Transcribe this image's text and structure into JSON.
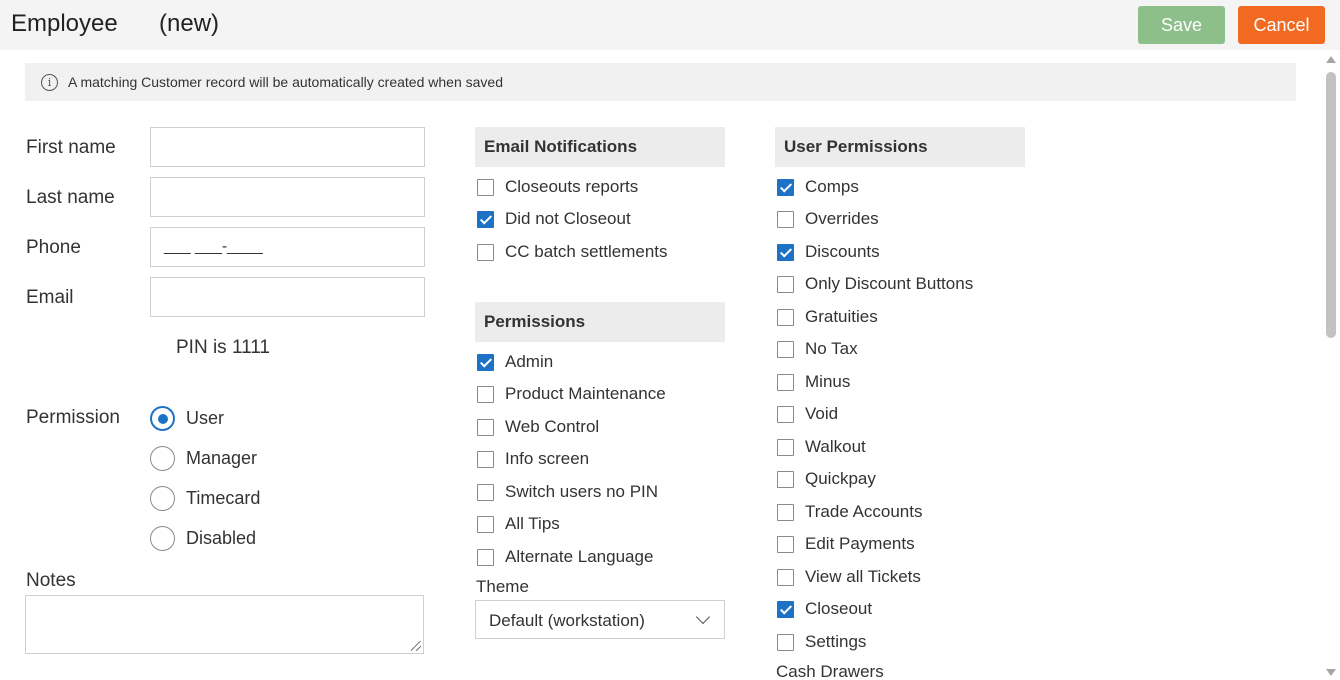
{
  "header": {
    "title": "Employee",
    "title_suffix": "(new)",
    "save_label": "Save",
    "cancel_label": "Cancel"
  },
  "info": {
    "icon_glyph": "i",
    "text": "A matching Customer record will be automatically created when saved"
  },
  "form": {
    "first_name_label": "First name",
    "first_name_value": "",
    "last_name_label": "Last name",
    "last_name_value": "",
    "phone_label": "Phone",
    "phone_value": "___ ___-____",
    "email_label": "Email",
    "email_value": "",
    "pin_text": "PIN is 1111"
  },
  "permission": {
    "label": "Permission",
    "options": [
      {
        "label": "User",
        "selected": true
      },
      {
        "label": "Manager",
        "selected": false
      },
      {
        "label": "Timecard",
        "selected": false
      },
      {
        "label": "Disabled",
        "selected": false
      }
    ]
  },
  "notes": {
    "label": "Notes",
    "value": ""
  },
  "email_notifications": {
    "heading": "Email Notifications",
    "items": [
      {
        "label": "Closeouts reports",
        "checked": false
      },
      {
        "label": "Did not Closeout",
        "checked": true
      },
      {
        "label": "CC batch settlements",
        "checked": false
      }
    ]
  },
  "permissions": {
    "heading": "Permissions",
    "items": [
      {
        "label": "Admin",
        "checked": true
      },
      {
        "label": "Product Maintenance",
        "checked": false
      },
      {
        "label": "Web Control",
        "checked": false
      },
      {
        "label": "Info screen",
        "checked": false
      },
      {
        "label": "Switch users no PIN",
        "checked": false
      },
      {
        "label": "All Tips",
        "checked": false
      },
      {
        "label": "Alternate Language",
        "checked": false
      }
    ]
  },
  "theme": {
    "label": "Theme",
    "selected": "Default (workstation)"
  },
  "user_permissions": {
    "heading": "User Permissions",
    "items": [
      {
        "label": "Comps",
        "checked": true
      },
      {
        "label": "Overrides",
        "checked": false
      },
      {
        "label": "Discounts",
        "checked": true
      },
      {
        "label": "Only Discount Buttons",
        "checked": false
      },
      {
        "label": "Gratuities",
        "checked": false
      },
      {
        "label": "No Tax",
        "checked": false
      },
      {
        "label": "Minus",
        "checked": false
      },
      {
        "label": "Void",
        "checked": false
      },
      {
        "label": "Walkout",
        "checked": false
      },
      {
        "label": "Quickpay",
        "checked": false
      },
      {
        "label": "Trade Accounts",
        "checked": false
      },
      {
        "label": "Edit Payments",
        "checked": false
      },
      {
        "label": "View all Tickets",
        "checked": false
      },
      {
        "label": "Closeout",
        "checked": true
      },
      {
        "label": "Settings",
        "checked": false
      }
    ]
  },
  "cash_drawers_label": "Cash Drawers",
  "colors": {
    "accent": "#1e72c6",
    "save": "#8dbf8a",
    "cancel": "#f26a21"
  }
}
